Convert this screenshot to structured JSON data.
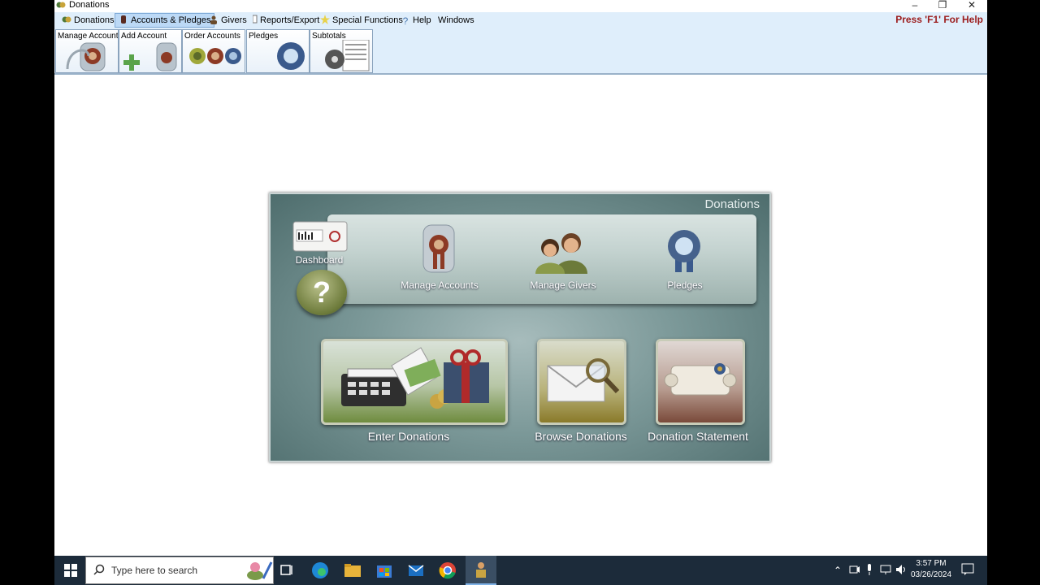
{
  "window": {
    "title": "Donations",
    "minimize": "–",
    "restore": "❐",
    "close": "✕"
  },
  "menu": {
    "items": [
      {
        "label": "Donations"
      },
      {
        "label": "Accounts & Pledges"
      },
      {
        "label": "Givers"
      },
      {
        "label": "Reports/Export"
      },
      {
        "label": "Special Functions"
      },
      {
        "label": "Help"
      },
      {
        "label": "Windows"
      }
    ],
    "help_hint": "Press 'F1' For Help"
  },
  "toolbar": {
    "buttons": [
      {
        "label": "Manage Accounts"
      },
      {
        "label": "Add Account"
      },
      {
        "label": "Order Accounts"
      },
      {
        "label": "Pledges"
      },
      {
        "label": "Subtotals"
      }
    ]
  },
  "panel": {
    "title": "Donations",
    "dashboard": "Dashboard",
    "help_glyph": "?",
    "top_items": [
      {
        "label": "Manage Accounts"
      },
      {
        "label": "Manage Givers"
      },
      {
        "label": "Pledges"
      }
    ],
    "bottom_items": [
      {
        "label": "Enter Donations"
      },
      {
        "label": "Browse Donations"
      },
      {
        "label": "Donation Statement"
      }
    ]
  },
  "taskbar": {
    "search_placeholder": "Type here to search",
    "time": "3:57 PM",
    "date": "03/26/2024"
  },
  "colors": {
    "accent_menu": "#bcd9f6",
    "help_hint": "#9b1b1b",
    "taskbar": "#1c2b3a"
  }
}
